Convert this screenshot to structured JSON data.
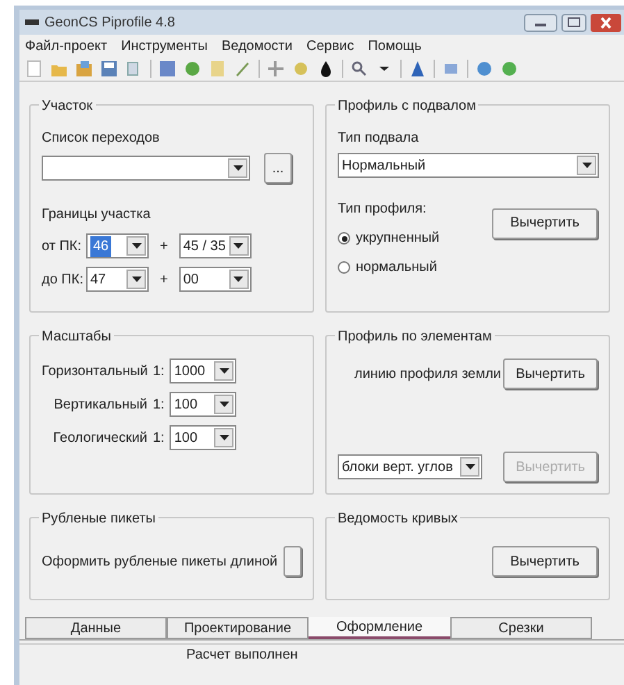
{
  "window": {
    "title": "GeonCS Piprofile 4.8"
  },
  "menu": [
    "Файл-проект",
    "Инструменты",
    "Ведомости",
    "Сервис",
    "Помощь"
  ],
  "section": {
    "title": "Участок",
    "list_label": "Список переходов",
    "browse_button": "...",
    "bounds_label": "Границы участка",
    "from_label": "от ПК:",
    "from_pk": "46",
    "from_plus": "45 / 35",
    "to_label": "до ПК:",
    "to_pk": "47",
    "to_plus": "00",
    "plus_sign": "+"
  },
  "profile_basement": {
    "title": "Профиль с подвалом",
    "basement_label": "Тип подвала",
    "basement_value": "Нормальный",
    "profile_label": "Тип профиля:",
    "draw_button": "Вычертить",
    "options": [
      {
        "label": "укрупненный",
        "selected": true
      },
      {
        "label": "нормальный",
        "selected": false
      }
    ]
  },
  "scales": {
    "title": "Масштабы",
    "rows": [
      {
        "label": "Горизонтальный",
        "ratio": "1:",
        "value": "1000"
      },
      {
        "label": "Вертикальный",
        "ratio": "1:",
        "value": "100"
      },
      {
        "label": "Геологический",
        "ratio": "1:",
        "value": "100"
      }
    ]
  },
  "chopped": {
    "title": "Рубленые пикеты",
    "label": "Оформить рубленые пикеты длиной"
  },
  "profile_elements": {
    "title": "Профиль по элементам",
    "line_label": "линию профиля земли",
    "line_button": {
      "label": "Вычертить",
      "disabled": false
    },
    "select_value": "блоки верт. углов",
    "select_button": {
      "label": "Вычертить",
      "disabled": true
    }
  },
  "curves": {
    "title": "Ведомость кривых",
    "button": "Вычертить"
  },
  "tabs": [
    {
      "label": "Данные",
      "selected": false
    },
    {
      "label": "Проектирование",
      "selected": false
    },
    {
      "label": "Оформление",
      "selected": true
    },
    {
      "label": "Срезки",
      "selected": false
    }
  ],
  "status_bar": "Расчет выполнен"
}
